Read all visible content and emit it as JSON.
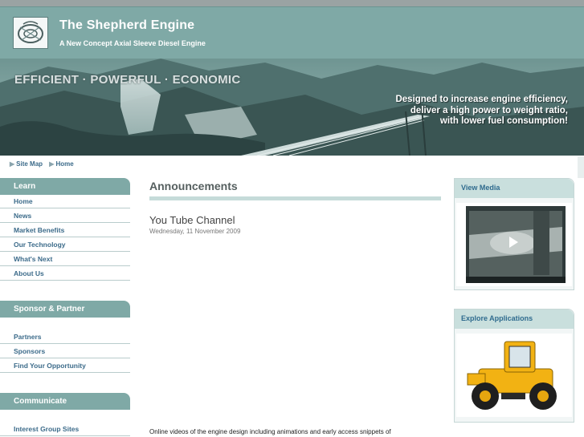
{
  "header": {
    "title": "The Shepherd Engine",
    "subtitle": "A New Concept Axial Sleeve Diesel Engine"
  },
  "banner": {
    "tagline": "EFFICIENT · POWERFUL · ECONOMIC",
    "lines": [
      "Designed to increase engine efficiency,",
      "deliver a high power to weight ratio,",
      "with lower fuel consumption!"
    ]
  },
  "breadcrumb": {
    "items": [
      "Site Map",
      "Home"
    ]
  },
  "sidebar": {
    "sections": [
      {
        "title": "Learn",
        "items": [
          "Home",
          "News",
          "Market Benefits",
          "Our Technology",
          "What's Next",
          "About Us"
        ]
      },
      {
        "title": "Sponsor & Partner",
        "items": [
          "Partners",
          "Sponsors",
          "Find Your Opportunity"
        ]
      },
      {
        "title": "Communicate",
        "items": [
          "Interest Group Sites"
        ]
      }
    ]
  },
  "main": {
    "title": "Announcements",
    "article": {
      "title": "You Tube Channel",
      "date": "Wednesday, 11 November 2009",
      "body": "Online videos of the engine design including animations and early access snippets of"
    }
  },
  "right": {
    "media": {
      "title": "View Media"
    },
    "apps": {
      "title": "Explore Applications"
    }
  },
  "colors": {
    "header": "#7fa9a6",
    "link": "#3c6b8a",
    "panel_head": "#c9dfdd"
  }
}
